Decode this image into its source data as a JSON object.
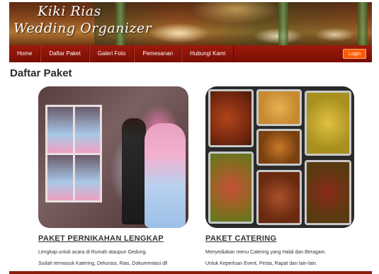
{
  "brand": {
    "line1": "Kiki Rias",
    "line2": "Wedding Organizer"
  },
  "nav": {
    "items": [
      "Home",
      "Daftar Paket",
      "Galeri Foto",
      "Pemesanan",
      "Hubungi Kami"
    ],
    "login_label": "Login"
  },
  "page": {
    "title": "Daftar Paket"
  },
  "packages": [
    {
      "title": "PAKET PERNIKAHAN LENGKAP",
      "desc1": "Lengkap untuk acara di Rumah ataupun Gedung.",
      "desc2": "Sudah termasuk Katering, Dekorasi, Rias, Dokumentasi dll"
    },
    {
      "title": "PAKET CATERING",
      "desc1": "Menyediakan menu Catering yang Halal dan Beragam.",
      "desc2": "Untuk Keperluan Event, Pesta, Rapat dan lain-lain."
    }
  ],
  "colors": {
    "nav": "#8a1408",
    "login": "#ff5a00",
    "footer": "#8a1a0a"
  }
}
